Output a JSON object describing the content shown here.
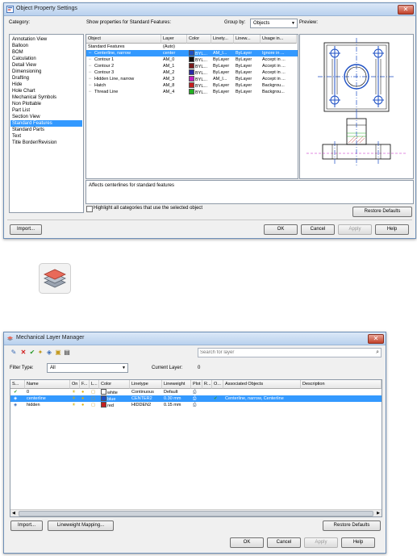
{
  "ops": {
    "title": "Object Property Settings",
    "category_label": "Category:",
    "show_props_label": "Show properties for Standard Features:",
    "group_by_label": "Group by:",
    "group_by_value": "Objects",
    "preview_label": "Preview:",
    "categories": [
      "Annotation View",
      "Balloon",
      "BOM",
      "Calculation",
      "Detail View",
      "Dimensioning",
      "Drafting",
      "Hide",
      "Hole Chart",
      "Mechanical Symbols",
      "Non Plottable",
      "Part List",
      "Section View",
      "Standard Features",
      "Standard Parts",
      "Text",
      "Title Border/Revision"
    ],
    "selected_category": "Standard Features",
    "columns": [
      "Object",
      "Layer",
      "Color",
      "Linety...",
      "Linew...",
      "Usage in..."
    ],
    "group_row": {
      "object": "Standard Features",
      "layer": "(Auto)"
    },
    "rows": [
      {
        "object": "Centerline, narrow",
        "layer": "center",
        "color": "BYL...",
        "linetype": "AM_I...",
        "lineweight": "ByLayer",
        "usage": "Ignore in ...",
        "swatch": "#1d4fc4",
        "selected": true
      },
      {
        "object": "Contour 1",
        "layer": "AM_0",
        "color": "BYL...",
        "linetype": "ByLayer",
        "lineweight": "ByLayer",
        "usage": "Accept in ...",
        "swatch": "#111111",
        "selected": false
      },
      {
        "object": "Contour 2",
        "layer": "AM_1",
        "color": "BYL...",
        "linetype": "ByLayer",
        "lineweight": "ByLayer",
        "usage": "Accept in ...",
        "swatch": "#7a1a1a",
        "selected": false
      },
      {
        "object": "Contour 3",
        "layer": "AM_2",
        "color": "BYL...",
        "linetype": "ByLayer",
        "lineweight": "ByLayer",
        "usage": "Accept in ...",
        "swatch": "#2a2aa8",
        "selected": false
      },
      {
        "object": "Hidden Line, narrow",
        "layer": "AM_3",
        "color": "BYL...",
        "linetype": "AM_I...",
        "lineweight": "ByLayer",
        "usage": "Accept in ...",
        "swatch": "#c21fc2",
        "selected": false
      },
      {
        "object": "Hatch",
        "layer": "AM_8",
        "color": "BYL...",
        "linetype": "ByLayer",
        "lineweight": "ByLayer",
        "usage": "Backgrou...",
        "swatch": "#c42020",
        "selected": false
      },
      {
        "object": "Thread Line",
        "layer": "AM_4",
        "color": "BYL...",
        "linetype": "ByLayer",
        "lineweight": "ByLayer",
        "usage": "Backgrou...",
        "swatch": "#22b022",
        "selected": false
      }
    ],
    "description": "Affects centerlines for standard features",
    "highlight_label": "Highlight all categories that use the selected object",
    "restore_defaults": "Restore Defaults",
    "import": "Import...",
    "ok": "OK",
    "cancel": "Cancel",
    "apply": "Apply",
    "help": "Help"
  },
  "mlm": {
    "title": "Mechanical Layer Manager",
    "search_placeholder": "Search for layer",
    "filter_type_label": "Filter Type:",
    "filter_type_value": "All",
    "current_layer_label": "Current Layer:",
    "current_layer_value": "0",
    "columns": [
      "S...",
      "Name",
      "On",
      "F...",
      "L...",
      "Color",
      "Linetype",
      "Lineweight",
      "Plot",
      "R...",
      "O...",
      "Associated Objects",
      "Description"
    ],
    "rows": [
      {
        "name": "0",
        "color_name": "white",
        "swatch": "#ffffff",
        "linetype": "Continuous",
        "lineweight": "Default",
        "associated": "",
        "selected": false,
        "status": "current"
      },
      {
        "name": "centerline",
        "color_name": "blue",
        "swatch": "#1d4fc4",
        "linetype": "CENTER2",
        "lineweight": "0.30 mm",
        "associated": "Centerline, narrow, Centerline",
        "selected": true,
        "status": "layer"
      },
      {
        "name": "hidden",
        "color_name": "red",
        "swatch": "#c42020",
        "linetype": "HIDDEN2",
        "lineweight": "0.15 mm",
        "associated": "",
        "selected": false,
        "status": "layer"
      }
    ],
    "import": "Import...",
    "lineweight_mapping": "Lineweight Mapping...",
    "restore_defaults": "Restore Defaults",
    "ok": "OK",
    "cancel": "Cancel",
    "apply": "Apply",
    "help": "Help"
  },
  "icons": {
    "layer_stack": "layer-stack-icon",
    "close": "close-icon"
  }
}
